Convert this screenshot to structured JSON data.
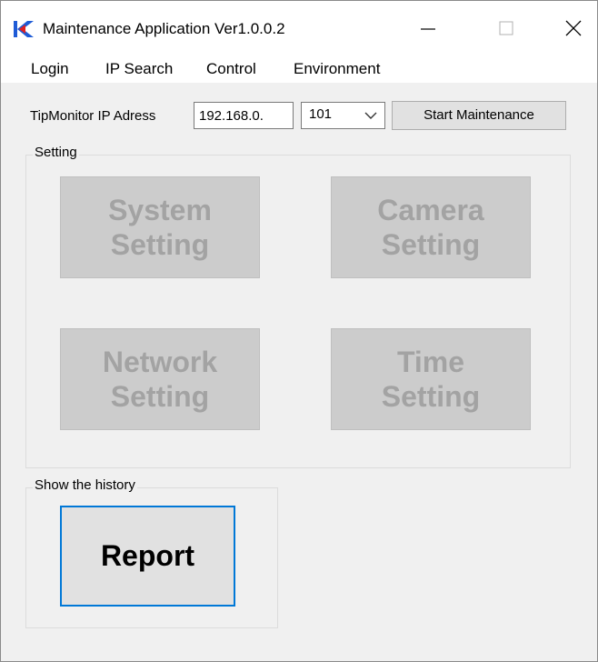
{
  "window": {
    "title": "Maintenance Application Ver1.0.0.2",
    "controls": {
      "minimize": "minimize-icon",
      "maximize": "maximize-icon",
      "close": "close-icon"
    }
  },
  "menu": {
    "items": [
      {
        "label": "Login"
      },
      {
        "label": "IP Search"
      },
      {
        "label": "Control"
      },
      {
        "label": "Environment"
      }
    ]
  },
  "ip_row": {
    "label": "TipMonitor IP Adress",
    "prefix_value": "192.168.0.",
    "last_octet": "101",
    "start_button": "Start Maintenance"
  },
  "setting_group": {
    "label": "Setting",
    "buttons": [
      {
        "line1": "System",
        "line2": "Setting",
        "enabled": false
      },
      {
        "line1": "Camera",
        "line2": "Setting",
        "enabled": false
      },
      {
        "line1": "Network",
        "line2": "Setting",
        "enabled": false
      },
      {
        "line1": "Time",
        "line2": "Setting",
        "enabled": false
      }
    ]
  },
  "history_group": {
    "label": "Show the history",
    "report_button": "Report"
  },
  "colors": {
    "window_bg": "#f0f0f0",
    "disabled_button_bg": "#cccccc",
    "disabled_text": "#a3a3a3",
    "focus_border": "#0078d7",
    "icon_blue": "#1e5bd6"
  }
}
